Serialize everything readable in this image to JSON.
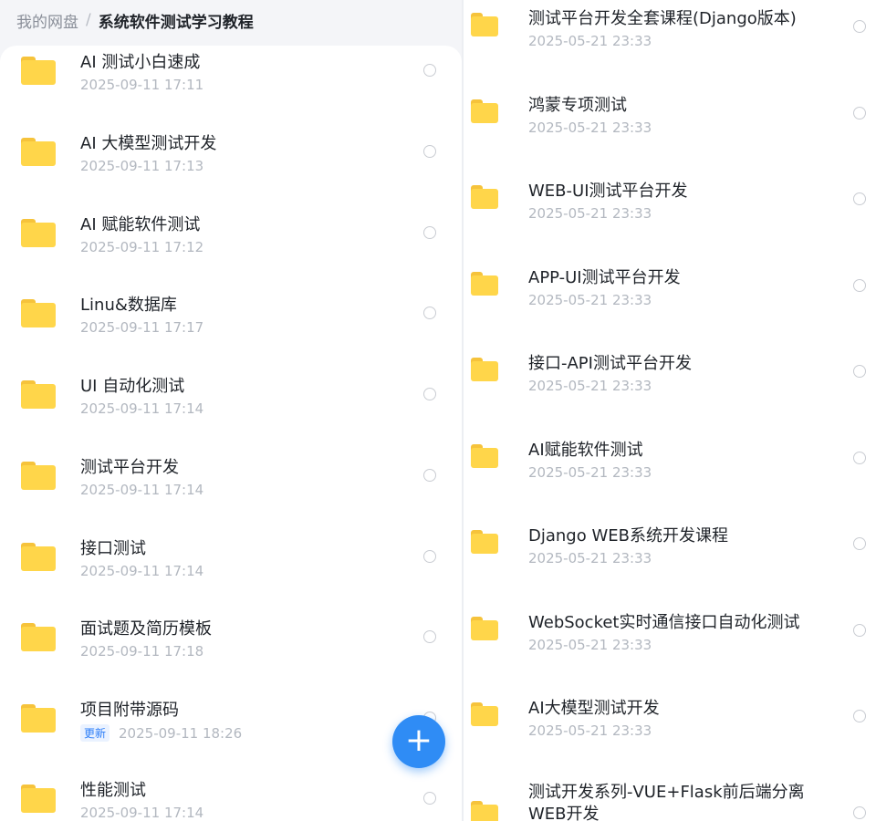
{
  "breadcrumb": {
    "root": "我的网盘",
    "separator": "/",
    "current": "系统软件测试学习教程"
  },
  "left_list": [
    {
      "name": "AI 测试小白速成",
      "date": "2025-09-11   17:11"
    },
    {
      "name": "AI 大模型测试开发",
      "date": "2025-09-11   17:13"
    },
    {
      "name": "AI 赋能软件测试",
      "date": "2025-09-11   17:12"
    },
    {
      "name": "Linu&数据库",
      "date": "2025-09-11   17:17"
    },
    {
      "name": "UI 自动化测试",
      "date": "2025-09-11   17:14"
    },
    {
      "name": "测试平台开发",
      "date": "2025-09-11   17:14"
    },
    {
      "name": "接口测试",
      "date": "2025-09-11   17:14"
    },
    {
      "name": "面试题及简历模板",
      "date": "2025-09-11   17:18"
    },
    {
      "name": "项目附带源码",
      "badge": "更新",
      "date": "2025-09-11   18:26"
    },
    {
      "name": "性能测试",
      "date": "2025-09-11   17:14"
    }
  ],
  "right_list": [
    {
      "name": "测试平台开发全套课程(Django版本)",
      "date": "2025-05-21   23:33"
    },
    {
      "name": "鸿蒙专项测试",
      "date": "2025-05-21   23:33"
    },
    {
      "name": "WEB-UI测试平台开发",
      "date": "2025-05-21   23:33"
    },
    {
      "name": "APP-UI测试平台开发",
      "date": "2025-05-21   23:33"
    },
    {
      "name": "接口-API测试平台开发",
      "date": "2025-05-21   23:33"
    },
    {
      "name": "AI赋能软件测试",
      "date": "2025-05-21   23:33"
    },
    {
      "name": "Django WEB系统开发课程",
      "date": "2025-05-21   23:33"
    },
    {
      "name": "WebSocket实时通信接口自动化测试",
      "date": "2025-05-21   23:33"
    },
    {
      "name": "AI大模型测试开发",
      "date": "2025-05-21   23:33"
    },
    {
      "name": "测试开发系列-VUE+Flask前后端分离",
      "name_line2": "WEB开发"
    }
  ],
  "fab": {
    "icon": "plus-icon",
    "symbol": "+"
  },
  "colors": {
    "accent": "#2f8cf5",
    "folder": "#ffd64a",
    "badge_text": "#2c7ef8"
  }
}
